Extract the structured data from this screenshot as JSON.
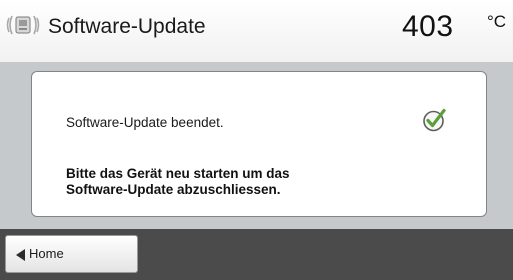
{
  "header": {
    "title": "Software-Update",
    "temperature": "403",
    "unit": "°C",
    "icon": "furnace-icon"
  },
  "dialog": {
    "message": "Software-Update beendet.",
    "status_icon": "checkmark-icon",
    "instruction_line1": "Bitte das Gerät neu starten um das",
    "instruction_line2": "Software-Update abzuschliessen."
  },
  "footer": {
    "home_label": "Home",
    "home_icon": "arrow-left-icon"
  },
  "colors": {
    "content_background": "#c6c9cc",
    "footer_background": "#4b4b4b",
    "check_accent": "#5aa03a"
  }
}
